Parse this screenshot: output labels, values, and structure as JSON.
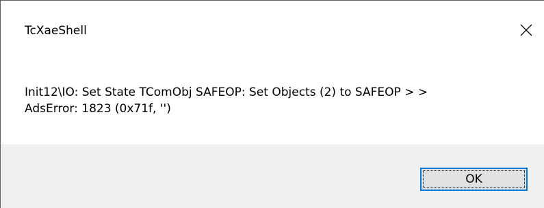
{
  "window": {
    "title": "TcXaeShell",
    "close_icon": "close-icon"
  },
  "message": {
    "line1": "Init12\\IO: Set State TComObj SAFEOP: Set Objects (2) to SAFEOP > >",
    "line2": "AdsError: 1823 (0x71f, '')"
  },
  "buttons": {
    "ok_label": "OK"
  },
  "colors": {
    "footer_bg": "#f0f0f0",
    "button_bg": "#e1e1e1",
    "button_focus_border": "#0078d7"
  }
}
